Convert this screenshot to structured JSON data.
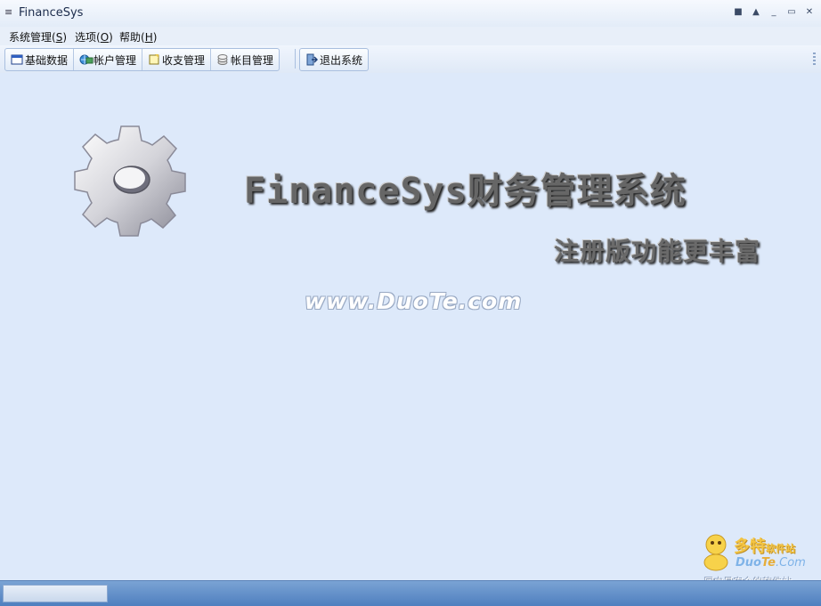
{
  "window": {
    "title": "FinanceSys",
    "system_menu_glyph": "≡",
    "controls": [
      "■",
      "▲",
      "_",
      "▭",
      "✕"
    ]
  },
  "menubar": {
    "items": [
      {
        "label": "系统管理(",
        "accel": "S",
        "suffix": ")"
      },
      {
        "label": "选项(",
        "accel": "O",
        "suffix": ")"
      },
      {
        "label": "帮助(",
        "accel": "H",
        "suffix": ")"
      }
    ]
  },
  "toolbar": {
    "buttons": [
      {
        "label": "基础数据",
        "icon": "window-icon"
      },
      {
        "label": "帐户管理",
        "icon": "globe-card-icon"
      },
      {
        "label": "收支管理",
        "icon": "note-icon"
      },
      {
        "label": "帐目管理",
        "icon": "coins-icon"
      }
    ],
    "exit_button": {
      "label": "退出系统",
      "icon": "exit-door-icon"
    }
  },
  "main": {
    "title": "FinanceSys财务管理系统",
    "subtitle": "注册版功能更丰富",
    "watermark": "www.DuoTe.com"
  },
  "corner_logo": {
    "brand": "多特",
    "brand_small": "软件站",
    "site_prefix": "Duo",
    "site_mid": "Te",
    "site_suffix": ".Com",
    "slogan": "国内最安全的软件站"
  },
  "colors": {
    "background": "#dde9fa",
    "statusbar": "#5d8ac6",
    "toolbar_border": "#a9bfdf"
  }
}
